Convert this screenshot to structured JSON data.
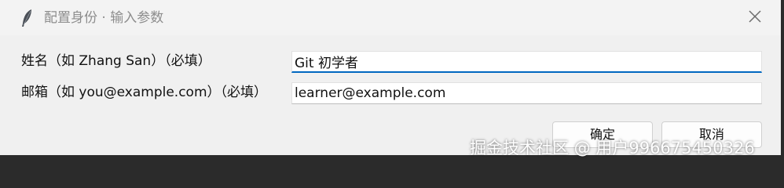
{
  "window": {
    "title": "配置身份 · 输入参数",
    "app_icon": "feather-icon",
    "close_icon": "close-icon"
  },
  "form": {
    "name_label": "姓名（如 Zhang San）（必填）",
    "name_value": "Git 初学者",
    "email_label": "邮箱（如 you@example.com）（必填）",
    "email_value": "learner@example.com"
  },
  "buttons": {
    "ok": "确定",
    "cancel": "取消"
  },
  "watermark": "掘金技术社区 @ 用户996675450326",
  "colors": {
    "focus_accent": "#0067c0"
  }
}
